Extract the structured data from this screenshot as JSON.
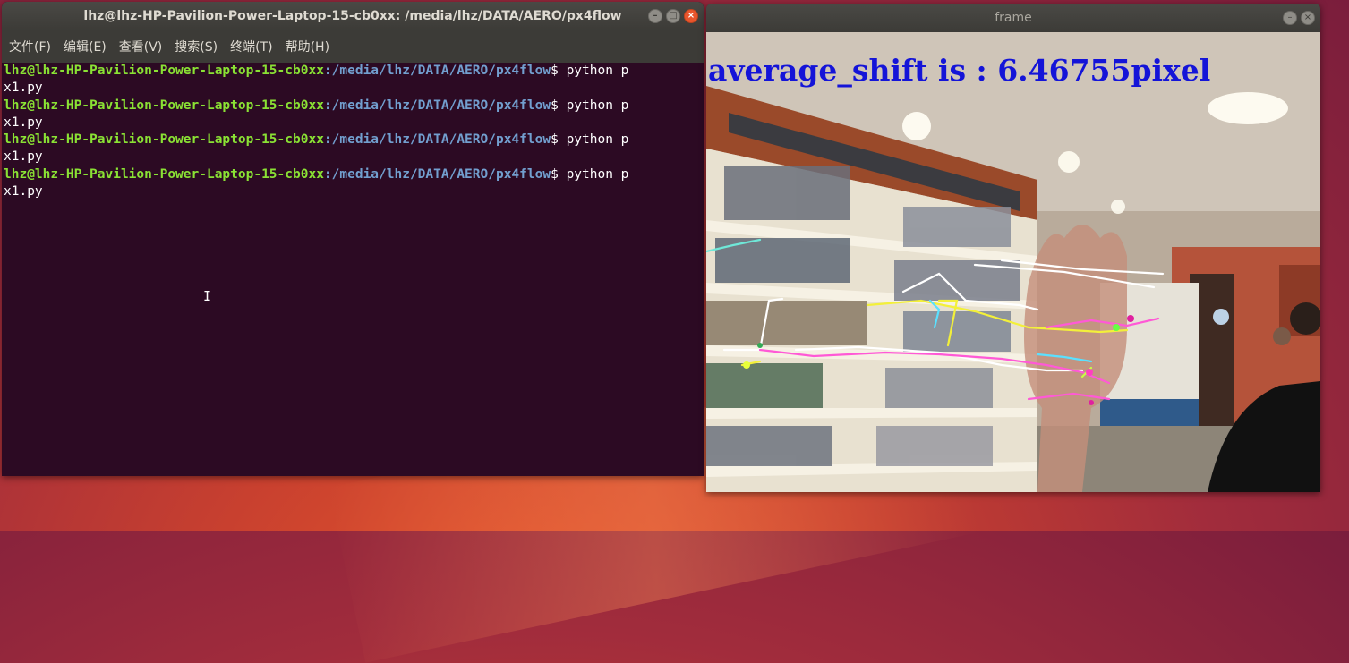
{
  "terminal": {
    "title": "lhz@lhz-HP-Pavilion-Power-Laptop-15-cb0xx: /media/lhz/DATA/AERO/px4flow",
    "menu": [
      "文件(F)",
      "编辑(E)",
      "查看(V)",
      "搜索(S)",
      "终端(T)",
      "帮助(H)"
    ],
    "prompt_user": "lhz@lhz-HP-Pavilion-Power-Laptop-15-cb0xx",
    "prompt_path": ":/media/lhz/DATA/AERO/px4flow",
    "prompt_sign": "$ ",
    "command_line1": "python p",
    "command_line2": "x1.py",
    "cursor_glyph": "I"
  },
  "frame": {
    "title": "frame",
    "overlay_text": "average_shift is : 6.46755pixel",
    "overlay_color": "#1414d8"
  },
  "window_buttons": {
    "minimize": "–",
    "maximize": "□",
    "close": "×"
  }
}
